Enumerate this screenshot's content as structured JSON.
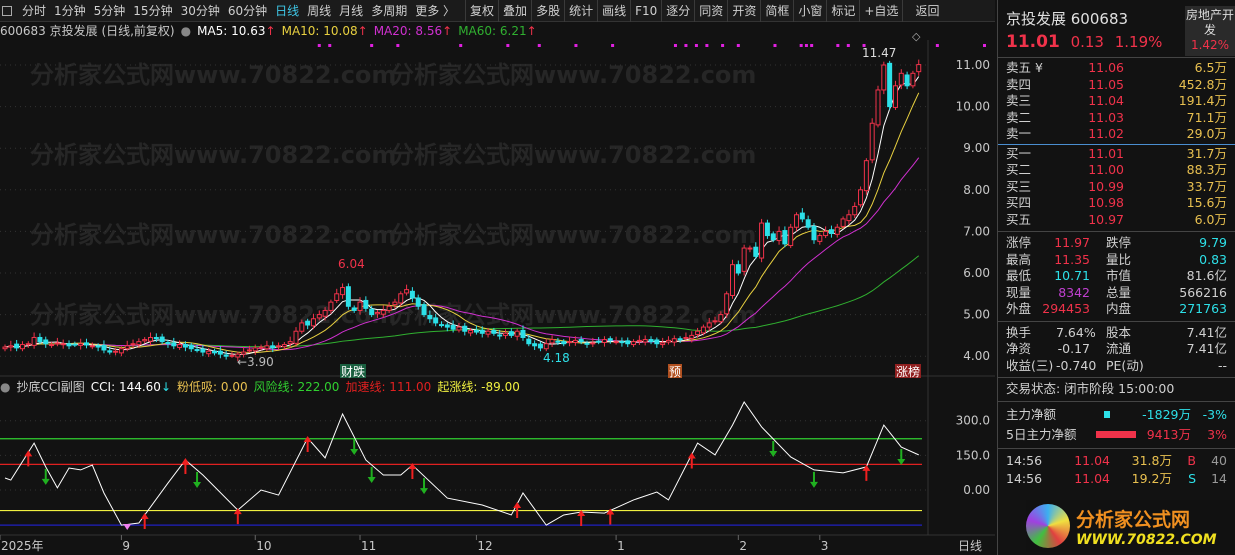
{
  "toolbar": {
    "periods": [
      "分时",
      "1分钟",
      "5分钟",
      "15分钟",
      "30分钟",
      "60分钟",
      "日线",
      "周线",
      "月线",
      "多周期",
      "更多 〉"
    ],
    "active": "日线",
    "tools": [
      "复权",
      "叠加",
      "多股",
      "统计",
      "画线",
      "F10",
      "逐分",
      "同资",
      "开资",
      "简框",
      "小窗",
      "标记",
      "+自选",
      "返回"
    ]
  },
  "info": {
    "title": "600683 京投发展 (日线,前复权)",
    "ma5": "MA5: 10.63",
    "ma10": "MA10: 10.08",
    "ma20": "MA20: 8.56",
    "ma60": "MA60: 6.21",
    "arrow": "↑"
  },
  "colors": {
    "up": "#f0324a",
    "down": "#2de0e8",
    "ma5": "#ffffff",
    "ma10": "#e8d040",
    "ma20": "#d030d0",
    "ma60": "#30b030",
    "cci": "#ffffff",
    "risk": "#30d030",
    "accel": "#e02020",
    "rise": "#f0f040",
    "low": "#2020c0"
  },
  "watermark": "分析家公式网www.70822.com",
  "chart_data": {
    "type": "candlestick",
    "price_ticks": [
      "11.00",
      "10.00",
      "9.00",
      "8.00",
      "7.00",
      "6.00",
      "5.00",
      "4.00"
    ],
    "closes": [
      4.22,
      4.25,
      4.2,
      4.28,
      4.3,
      4.45,
      4.35,
      4.3,
      4.28,
      4.32,
      4.3,
      4.25,
      4.28,
      4.3,
      4.27,
      4.25,
      4.22,
      4.15,
      4.1,
      4.12,
      4.18,
      4.25,
      4.3,
      4.35,
      4.4,
      4.45,
      4.42,
      4.35,
      4.3,
      4.25,
      4.28,
      4.22,
      4.18,
      4.15,
      4.1,
      4.12,
      4.08,
      4.05,
      4.0,
      4.02,
      4.05,
      4.1,
      4.15,
      4.2,
      4.22,
      4.25,
      4.2,
      4.25,
      4.28,
      4.35,
      4.6,
      4.8,
      4.75,
      4.9,
      5.0,
      5.1,
      5.3,
      5.5,
      5.65,
      5.2,
      5.1,
      5.3,
      5.15,
      5.0,
      5.05,
      5.1,
      5.2,
      5.3,
      5.5,
      5.6,
      5.4,
      5.2,
      5.0,
      4.9,
      4.8,
      4.75,
      4.7,
      4.65,
      4.7,
      4.6,
      4.62,
      4.58,
      4.55,
      4.6,
      4.55,
      4.5,
      4.55,
      4.5,
      4.6,
      4.45,
      4.3,
      4.25,
      4.2,
      4.3,
      4.4,
      4.35,
      4.3,
      4.35,
      4.38,
      4.35,
      4.3,
      4.32,
      4.35,
      4.4,
      4.38,
      4.35,
      4.33,
      4.3,
      4.35,
      4.38,
      4.4,
      4.35,
      4.3,
      4.32,
      4.38,
      4.42,
      4.4,
      4.45,
      4.5,
      4.6,
      4.7,
      4.8,
      4.85,
      5.0,
      5.5,
      6.2,
      6.0,
      6.6,
      6.6,
      6.4,
      7.2,
      6.9,
      6.8,
      7.0,
      6.7,
      7.1,
      7.4,
      7.3,
      7.1,
      6.8,
      6.9,
      7.0,
      6.95,
      7.1,
      7.3,
      7.4,
      7.6,
      8.0,
      8.7,
      9.6,
      10.4,
      11.0,
      10.0,
      10.5,
      10.8,
      10.5,
      10.8,
      11.01
    ],
    "annotations": {
      "high_mid": "6.04",
      "low_left": "←3.90",
      "low_mid": "4.18",
      "high_max": "11.47"
    },
    "markers": [
      "财跌",
      "预",
      "涨榜"
    ],
    "x_ticks": [
      "2025年",
      "9",
      "10",
      "11",
      "12",
      "1",
      "2",
      "3"
    ],
    "period_label": "日线",
    "cci_ticks": [
      "300.0",
      "150.0",
      "0.00"
    ],
    "cci": [
      [
        0,
        52
      ],
      [
        1,
        43
      ],
      [
        5,
        203
      ],
      [
        7,
        100
      ],
      [
        9,
        9
      ],
      [
        11,
        95
      ],
      [
        13,
        87
      ],
      [
        15,
        108
      ],
      [
        17,
        -13
      ],
      [
        20,
        -152
      ],
      [
        23,
        -143
      ],
      [
        28,
        30
      ],
      [
        31,
        130
      ],
      [
        34,
        65
      ],
      [
        40,
        -87
      ],
      [
        44,
        0
      ],
      [
        47,
        -22
      ],
      [
        52,
        225
      ],
      [
        55,
        139
      ],
      [
        58,
        329
      ],
      [
        62,
        130
      ],
      [
        65,
        65
      ],
      [
        68,
        65
      ],
      [
        70,
        108
      ],
      [
        76,
        -35
      ],
      [
        82,
        -65
      ],
      [
        87,
        -108
      ],
      [
        89,
        -13
      ],
      [
        93,
        -152
      ],
      [
        96,
        -108
      ],
      [
        99,
        -95
      ],
      [
        103,
        -100
      ],
      [
        108,
        -43
      ],
      [
        112,
        -9
      ],
      [
        114,
        -43
      ],
      [
        119,
        203
      ],
      [
        122,
        152
      ],
      [
        125,
        281
      ],
      [
        127,
        381
      ],
      [
        130,
        273
      ],
      [
        135,
        143
      ],
      [
        139,
        87
      ],
      [
        144,
        74
      ],
      [
        148,
        100
      ],
      [
        151,
        281
      ],
      [
        154,
        186
      ],
      [
        157,
        152
      ]
    ],
    "cci_lines": {
      "risk": 222,
      "accel": 111,
      "rise": -89,
      "low": -152
    },
    "buy_arrows": [
      4,
      31,
      24,
      40,
      52,
      70,
      88,
      99,
      104,
      118,
      148
    ],
    "sell_arrows": [
      7,
      33,
      60,
      63,
      72,
      132,
      139,
      154
    ],
    "top_dots": [
      60,
      62,
      70,
      75,
      87,
      96,
      102,
      109,
      116,
      128,
      130,
      132,
      134,
      137,
      140,
      147,
      152,
      153,
      154,
      159,
      161,
      164,
      178,
      187
    ]
  },
  "sub": {
    "name": "抄底CCI副图",
    "cci": "CCI: 144.60",
    "arrow": "↓",
    "pink": "粉低吸: 0.00",
    "risk": "风险线: 222.00",
    "accel": "加速线: 111.00",
    "rise": "起涨线: -89.00"
  },
  "quote": {
    "name": "京投发展 600683",
    "price": "11.01",
    "change": "0.13",
    "pct": "1.19%",
    "sector": "房地产开发",
    "sector_pct": "1.42%",
    "asks": [
      {
        "l": "卖五 ¥",
        "p": "11.06",
        "v": "6.5万"
      },
      {
        "l": "卖四",
        "p": "11.05",
        "v": "452.8万"
      },
      {
        "l": "卖三",
        "p": "11.04",
        "v": "191.4万"
      },
      {
        "l": "卖二",
        "p": "11.03",
        "v": "71.1万"
      },
      {
        "l": "卖一",
        "p": "11.02",
        "v": "29.0万"
      }
    ],
    "bids": [
      {
        "l": "买一",
        "p": "11.01",
        "v": "31.7万"
      },
      {
        "l": "买二",
        "p": "11.00",
        "v": "88.3万"
      },
      {
        "l": "买三",
        "p": "10.99",
        "v": "33.7万"
      },
      {
        "l": "买四",
        "p": "10.98",
        "v": "15.6万"
      },
      {
        "l": "买五",
        "p": "10.97",
        "v": "6.0万"
      }
    ],
    "stats": [
      [
        "涨停",
        "11.97",
        "red",
        "跌停",
        "9.79",
        "cyan"
      ],
      [
        "最高",
        "11.35",
        "red",
        "量比",
        "0.83",
        "cyan"
      ],
      [
        "最低",
        "10.71",
        "cyan",
        "市值",
        "81.6亿",
        "wht"
      ],
      [
        "现量",
        "8342",
        "purple",
        "总量",
        "566216",
        "wht"
      ],
      [
        "外盘",
        "294453",
        "red",
        "内盘",
        "271763",
        "cyan"
      ]
    ],
    "stats2": [
      [
        "换手",
        "7.64%",
        "股本",
        "7.41亿"
      ],
      [
        "净资",
        "-0.17",
        "流通",
        "7.41亿"
      ],
      [
        "收益(三)",
        "-0.740",
        "PE(动)",
        "--"
      ]
    ],
    "status": "交易状态: 闭市阶段 15:00:00",
    "flow": [
      {
        "l": "主力净额",
        "v": "-1829万",
        "p": "-3%"
      },
      {
        "l": "5日主力净额",
        "v": "9413万",
        "p": "3%"
      }
    ],
    "ticks": [
      {
        "t": "14:56",
        "p": "11.04",
        "v": "31.8万",
        "s": "B",
        "n": "40"
      },
      {
        "t": "14:56",
        "p": "11.04",
        "v": "19.2万",
        "s": "S",
        "n": "14"
      }
    ],
    "logo": {
      "cn": "分析家公式网",
      "url": "WWW.70822.COM"
    }
  }
}
